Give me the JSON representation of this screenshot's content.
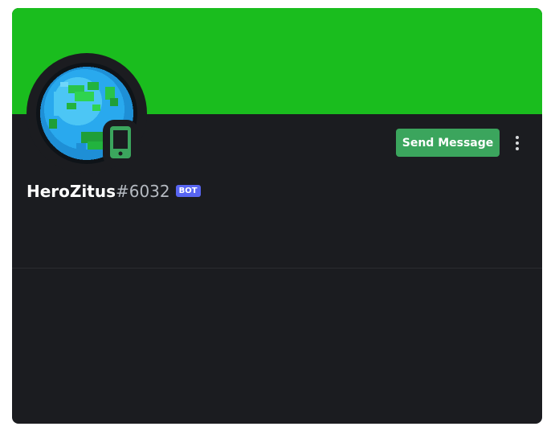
{
  "profile": {
    "username": "HeroZitus",
    "discriminator": "#6032",
    "bot_tag": "BOT",
    "status": "mobile-online"
  },
  "actions": {
    "send_message_label": "Send Message",
    "more_icon": "more-vertical-icon"
  },
  "avatar": {
    "icon": "pixel-earth-avatar"
  },
  "colors": {
    "banner": "#1abd1e",
    "card_background": "#1b1c20",
    "send_button": "#3ba55d",
    "status_online": "#3ba55d",
    "bot_tag": "#5865f2",
    "discriminator": "#b5bac1"
  }
}
